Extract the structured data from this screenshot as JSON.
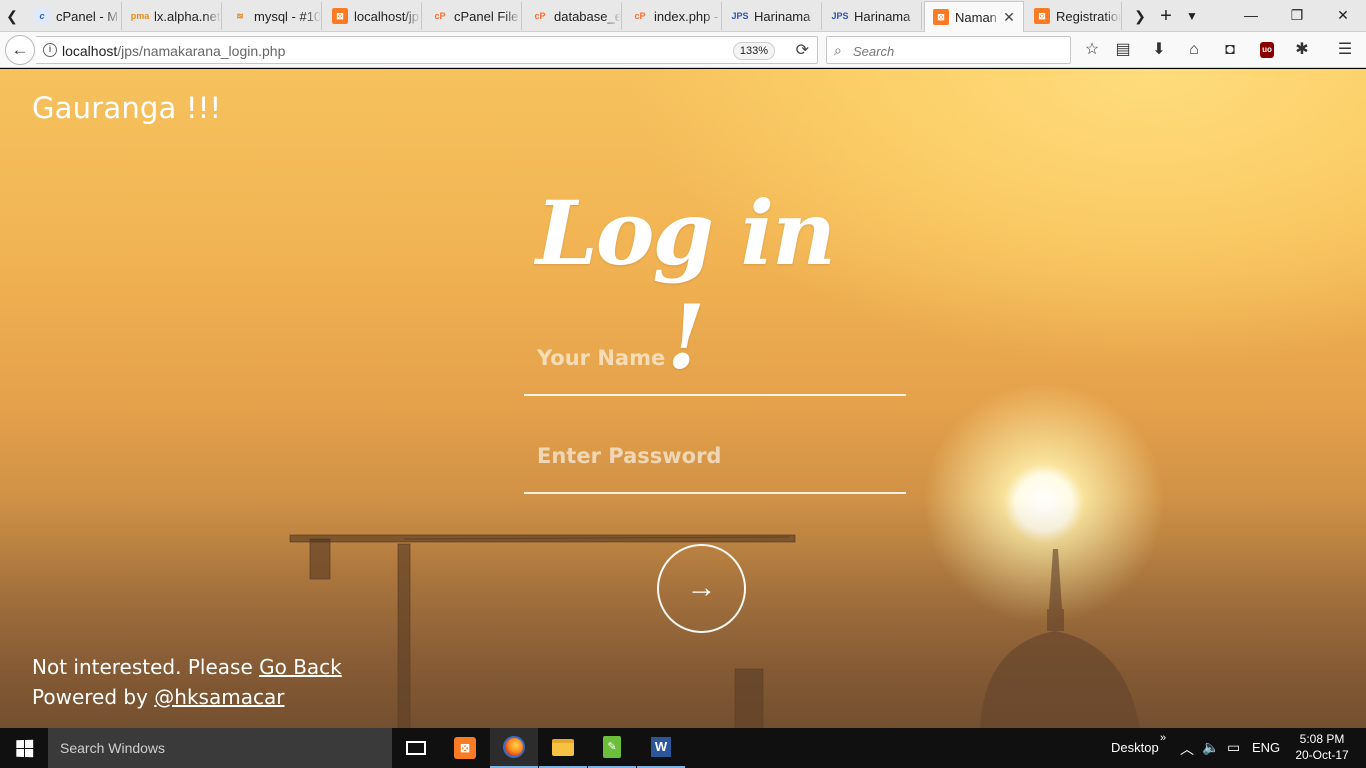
{
  "browser": {
    "tabs": [
      {
        "title": "cPanel - M",
        "icon": "cpanel-icon"
      },
      {
        "title": "lx.alpha.net",
        "icon": "phpmyadmin-icon"
      },
      {
        "title": "mysql - #10",
        "icon": "mysql-icon"
      },
      {
        "title": "localhost/jp",
        "icon": "xampp-icon"
      },
      {
        "title": "cPanel File",
        "icon": "cpanel-icon"
      },
      {
        "title": "database_e",
        "icon": "cpanel-icon"
      },
      {
        "title": "index.php -",
        "icon": "cpanel-icon"
      },
      {
        "title": "Harinama",
        "icon": "jps-icon"
      },
      {
        "title": "Harinama",
        "icon": "jps-icon"
      },
      {
        "title": "Naman",
        "icon": "xampp-icon",
        "active": true
      },
      {
        "title": "Registration",
        "icon": "xampp-icon"
      }
    ],
    "url": {
      "host": "localhost",
      "path": "/jps/namakarana_login.php"
    },
    "zoom": "133%",
    "search_placeholder": "Search"
  },
  "page": {
    "brand": "Gauranga !!!",
    "title": "Log in !",
    "name_placeholder": "Your Name",
    "password_placeholder": "Enter Password",
    "submit_glyph": "→",
    "footer": {
      "line1_prefix": "Not interested. Please ",
      "line1_link": "Go Back",
      "line2_prefix": "Powered by ",
      "line2_link": "@hksamacar"
    }
  },
  "taskbar": {
    "search_text": "Search Windows",
    "desktop_label": "Desktop",
    "language": "ENG",
    "time": "5:08 PM",
    "date": "20-Oct-17"
  },
  "colors": {
    "sky_top": "#f6c25e",
    "sky_bottom": "#7c5533",
    "accent": "#ffffff"
  }
}
